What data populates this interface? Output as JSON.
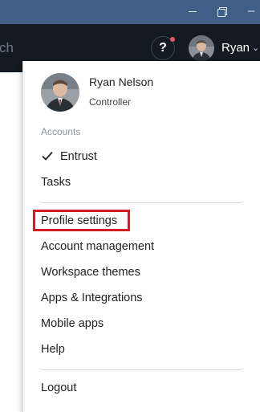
{
  "window": {
    "minimize_icon": "minimize-icon",
    "restore_icon": "restore-icon",
    "close_icon": "close-icon",
    "close_glyph": "–"
  },
  "header": {
    "search_text": "ch",
    "help_label": "?",
    "notification_color": "#e45862",
    "user_short_name": "Ryan",
    "caret": "⌄"
  },
  "menu": {
    "user": {
      "name": "Ryan Nelson",
      "role": "Controller"
    },
    "accounts_label": "Accounts",
    "accounts": [
      {
        "label": "Entrust",
        "selected": true
      },
      {
        "label": "Tasks",
        "selected": false
      }
    ],
    "items": [
      {
        "label": "Profile settings",
        "highlighted": true
      },
      {
        "label": "Account management"
      },
      {
        "label": "Workspace themes"
      },
      {
        "label": "Apps & Integrations"
      },
      {
        "label": "Mobile apps"
      },
      {
        "label": "Help"
      }
    ],
    "logout_label": "Logout",
    "highlight_color": "#d51b22"
  }
}
